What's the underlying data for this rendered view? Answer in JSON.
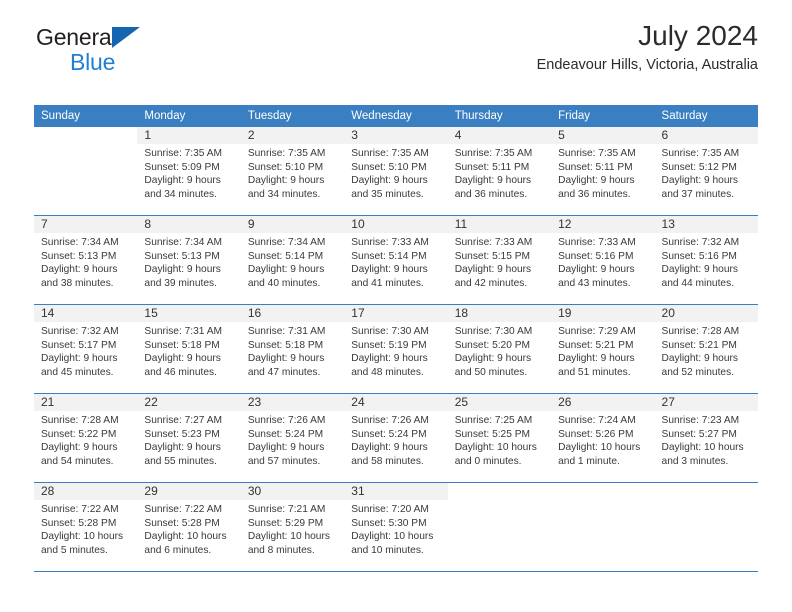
{
  "brand": {
    "name_part1": "General",
    "name_part2": "Blue",
    "triangle_color": "#1565b0",
    "blue_text_color": "#1f7fd0"
  },
  "header": {
    "title": "July 2024",
    "location": "Endeavour Hills, Victoria, Australia",
    "header_bg": "#3a7fc1",
    "daynum_bg": "#f2f2f2"
  },
  "calendar": {
    "weekday_headers": [
      "Sunday",
      "Monday",
      "Tuesday",
      "Wednesday",
      "Thursday",
      "Friday",
      "Saturday"
    ],
    "weeks": [
      [
        {
          "day": "",
          "info": ""
        },
        {
          "day": "1",
          "info": "Sunrise: 7:35 AM\nSunset: 5:09 PM\nDaylight: 9 hours\nand 34 minutes."
        },
        {
          "day": "2",
          "info": "Sunrise: 7:35 AM\nSunset: 5:10 PM\nDaylight: 9 hours\nand 34 minutes."
        },
        {
          "day": "3",
          "info": "Sunrise: 7:35 AM\nSunset: 5:10 PM\nDaylight: 9 hours\nand 35 minutes."
        },
        {
          "day": "4",
          "info": "Sunrise: 7:35 AM\nSunset: 5:11 PM\nDaylight: 9 hours\nand 36 minutes."
        },
        {
          "day": "5",
          "info": "Sunrise: 7:35 AM\nSunset: 5:11 PM\nDaylight: 9 hours\nand 36 minutes."
        },
        {
          "day": "6",
          "info": "Sunrise: 7:35 AM\nSunset: 5:12 PM\nDaylight: 9 hours\nand 37 minutes."
        }
      ],
      [
        {
          "day": "7",
          "info": "Sunrise: 7:34 AM\nSunset: 5:13 PM\nDaylight: 9 hours\nand 38 minutes."
        },
        {
          "day": "8",
          "info": "Sunrise: 7:34 AM\nSunset: 5:13 PM\nDaylight: 9 hours\nand 39 minutes."
        },
        {
          "day": "9",
          "info": "Sunrise: 7:34 AM\nSunset: 5:14 PM\nDaylight: 9 hours\nand 40 minutes."
        },
        {
          "day": "10",
          "info": "Sunrise: 7:33 AM\nSunset: 5:14 PM\nDaylight: 9 hours\nand 41 minutes."
        },
        {
          "day": "11",
          "info": "Sunrise: 7:33 AM\nSunset: 5:15 PM\nDaylight: 9 hours\nand 42 minutes."
        },
        {
          "day": "12",
          "info": "Sunrise: 7:33 AM\nSunset: 5:16 PM\nDaylight: 9 hours\nand 43 minutes."
        },
        {
          "day": "13",
          "info": "Sunrise: 7:32 AM\nSunset: 5:16 PM\nDaylight: 9 hours\nand 44 minutes."
        }
      ],
      [
        {
          "day": "14",
          "info": "Sunrise: 7:32 AM\nSunset: 5:17 PM\nDaylight: 9 hours\nand 45 minutes."
        },
        {
          "day": "15",
          "info": "Sunrise: 7:31 AM\nSunset: 5:18 PM\nDaylight: 9 hours\nand 46 minutes."
        },
        {
          "day": "16",
          "info": "Sunrise: 7:31 AM\nSunset: 5:18 PM\nDaylight: 9 hours\nand 47 minutes."
        },
        {
          "day": "17",
          "info": "Sunrise: 7:30 AM\nSunset: 5:19 PM\nDaylight: 9 hours\nand 48 minutes."
        },
        {
          "day": "18",
          "info": "Sunrise: 7:30 AM\nSunset: 5:20 PM\nDaylight: 9 hours\nand 50 minutes."
        },
        {
          "day": "19",
          "info": "Sunrise: 7:29 AM\nSunset: 5:21 PM\nDaylight: 9 hours\nand 51 minutes."
        },
        {
          "day": "20",
          "info": "Sunrise: 7:28 AM\nSunset: 5:21 PM\nDaylight: 9 hours\nand 52 minutes."
        }
      ],
      [
        {
          "day": "21",
          "info": "Sunrise: 7:28 AM\nSunset: 5:22 PM\nDaylight: 9 hours\nand 54 minutes."
        },
        {
          "day": "22",
          "info": "Sunrise: 7:27 AM\nSunset: 5:23 PM\nDaylight: 9 hours\nand 55 minutes."
        },
        {
          "day": "23",
          "info": "Sunrise: 7:26 AM\nSunset: 5:24 PM\nDaylight: 9 hours\nand 57 minutes."
        },
        {
          "day": "24",
          "info": "Sunrise: 7:26 AM\nSunset: 5:24 PM\nDaylight: 9 hours\nand 58 minutes."
        },
        {
          "day": "25",
          "info": "Sunrise: 7:25 AM\nSunset: 5:25 PM\nDaylight: 10 hours\nand 0 minutes."
        },
        {
          "day": "26",
          "info": "Sunrise: 7:24 AM\nSunset: 5:26 PM\nDaylight: 10 hours\nand 1 minute."
        },
        {
          "day": "27",
          "info": "Sunrise: 7:23 AM\nSunset: 5:27 PM\nDaylight: 10 hours\nand 3 minutes."
        }
      ],
      [
        {
          "day": "28",
          "info": "Sunrise: 7:22 AM\nSunset: 5:28 PM\nDaylight: 10 hours\nand 5 minutes."
        },
        {
          "day": "29",
          "info": "Sunrise: 7:22 AM\nSunset: 5:28 PM\nDaylight: 10 hours\nand 6 minutes."
        },
        {
          "day": "30",
          "info": "Sunrise: 7:21 AM\nSunset: 5:29 PM\nDaylight: 10 hours\nand 8 minutes."
        },
        {
          "day": "31",
          "info": "Sunrise: 7:20 AM\nSunset: 5:30 PM\nDaylight: 10 hours\nand 10 minutes."
        },
        {
          "day": "",
          "info": ""
        },
        {
          "day": "",
          "info": ""
        },
        {
          "day": "",
          "info": ""
        }
      ]
    ]
  }
}
